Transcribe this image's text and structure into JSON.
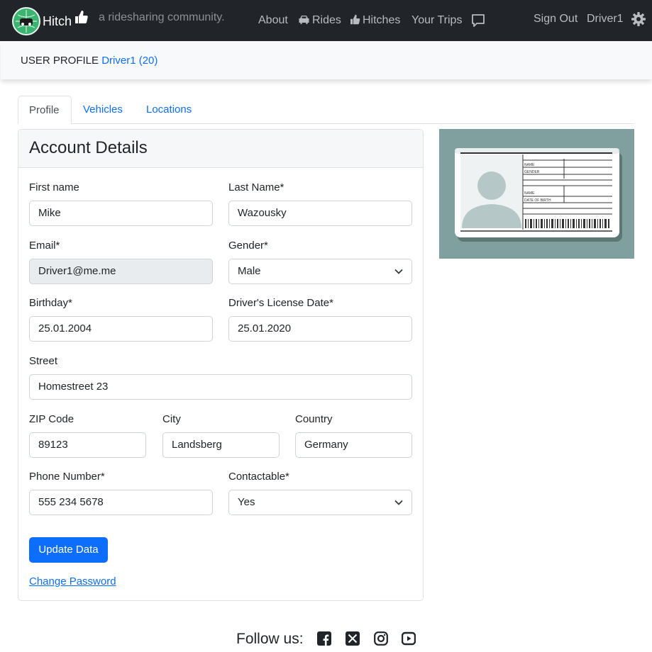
{
  "navbar": {
    "brand": "Hitch",
    "tagline": "a ridesharing community.",
    "about": "About",
    "rides": "Rides",
    "hitches": "Hitches",
    "trips": "Your Trips",
    "sign_out": "Sign Out",
    "user": "Driver1"
  },
  "profile_header": {
    "prefix": "USER PROFILE ",
    "user": "Driver1 (20)"
  },
  "tabs": [
    "Profile",
    "Vehicles",
    "Locations"
  ],
  "card": {
    "title": "Account Details",
    "first_name": {
      "label": "First name",
      "value": "Mike"
    },
    "last_name": {
      "label": "Last Name*",
      "value": "Wazousky"
    },
    "email": {
      "label": "Email*",
      "value": "Driver1@me.me"
    },
    "gender": {
      "label": "Gender*",
      "value": "Male"
    },
    "birthday": {
      "label": "Birthday*",
      "value": "25.01.2004"
    },
    "license_date": {
      "label": "Driver's License Date*",
      "value": "25.01.2020"
    },
    "street": {
      "label": "Street",
      "value": "Homestreet 23"
    },
    "zip": {
      "label": "ZIP Code",
      "value": "89123"
    },
    "city": {
      "label": "City",
      "value": "Landsberg"
    },
    "country": {
      "label": "Country",
      "value": "Germany"
    },
    "phone": {
      "label": "Phone Number*",
      "value": "555 234 5678"
    },
    "contactable": {
      "label": "Contactable*",
      "value": "Yes"
    },
    "update_button": "Update Data",
    "change_password": "Change Password"
  },
  "id_card": {
    "name_label": "NAME",
    "gender_label": "GENDER",
    "name_label_2": "NAME",
    "dob_label": "DATE OF BIRTH"
  },
  "footer": {
    "follow_us": "Follow us:",
    "socials": [
      "facebook-icon",
      "x-icon",
      "instagram-icon",
      "youtube-icon"
    ]
  },
  "colors": {
    "navbar": "#212529",
    "accent": "#0d6efd",
    "brand_green": "#3cb371",
    "id_background": "#7fa09f"
  }
}
